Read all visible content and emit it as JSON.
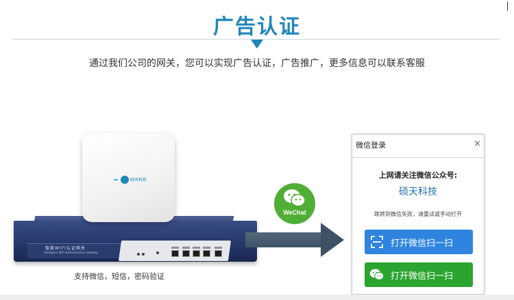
{
  "header": {
    "title": "广告认证",
    "intro": "通过我们公司的网关，您可以实现广告认证，广告推广，更多信息可以联系客服"
  },
  "illustration": {
    "router_label": "智能WIFI认证网关",
    "router_sublabel": "Intelligent WiFi Authentication Gateway",
    "ap_brand": "硕天科技",
    "caption": "支持微信，短信，密码验证",
    "badge_text": "WeChat"
  },
  "login_dialog": {
    "title": "微信登录",
    "close_glyph": "×",
    "prompt": "上网请关注微信公众号:",
    "account_name": "硕天科技",
    "hint": "跳转到微信失败，请重试或手动打开",
    "scan_button": "打开微信扫一扫",
    "open_button": "打开微信扫一扫"
  },
  "colors": {
    "accent": "#1f86b8",
    "scan_button": "#2f84e0",
    "wechat_green": "#2aa52f",
    "badge_green": "#4fae36"
  },
  "icons": {
    "scan": "scan-icon",
    "wechat": "wechat-icon",
    "close": "close-icon"
  }
}
